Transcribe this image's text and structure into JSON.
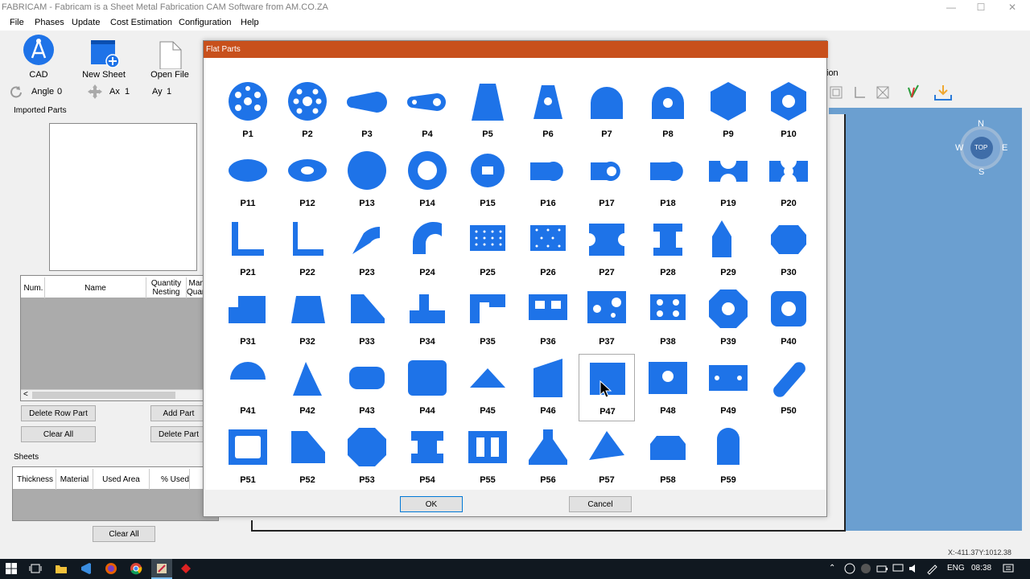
{
  "window": {
    "title": "FABRICAM - Fabricam is a Sheet Metal Fabrication CAM Software from AM.CO.ZA",
    "min": "—",
    "max": "☐",
    "close": "✕"
  },
  "menu": [
    "File",
    "Phases",
    "Update",
    "Cost Estimation",
    "Configuration",
    "Help"
  ],
  "toolbar": {
    "cad": "CAD",
    "new_sheet": "New Sheet",
    "open_file": "Open File",
    "angle_label": "Angle",
    "angle_value": "0",
    "ax_label": "Ax",
    "ax_value": "1",
    "ay_label": "Ay",
    "ay_value": "1"
  },
  "left_panel": {
    "imported_parts": "Imported Parts",
    "columns": [
      "Num.",
      "Name",
      "Quantity Nesting",
      "Man Quan"
    ],
    "delete_row": "Delete Row Part",
    "add_part": "Add Part",
    "clear_all": "Clear All",
    "delete_part": "Delete Part",
    "sheets": "Sheets",
    "sheet_columns": [
      "Thickness",
      "Material",
      "Used Area",
      "% Used"
    ],
    "sheets_clear_all": "Clear All"
  },
  "right": {
    "partial_tab": "ion",
    "compass": {
      "n": "N",
      "s": "S",
      "e": "E",
      "w": "W",
      "center": "TOP"
    },
    "coords": "X:-411.37Y:1012.38"
  },
  "dialog": {
    "title": "Flat Parts",
    "ok": "OK",
    "cancel": "Cancel",
    "selected": "P47",
    "parts": [
      "P1",
      "P2",
      "P3",
      "P4",
      "P5",
      "P6",
      "P7",
      "P8",
      "P9",
      "P10",
      "P11",
      "P12",
      "P13",
      "P14",
      "P15",
      "P16",
      "P17",
      "P18",
      "P19",
      "P20",
      "P21",
      "P22",
      "P23",
      "P24",
      "P25",
      "P26",
      "P27",
      "P28",
      "P29",
      "P30",
      "P31",
      "P32",
      "P33",
      "P34",
      "P35",
      "P36",
      "P37",
      "P38",
      "P39",
      "P40",
      "P41",
      "P42",
      "P43",
      "P44",
      "P45",
      "P46",
      "P47",
      "P48",
      "P49",
      "P50",
      "P51",
      "P52",
      "P53",
      "P54",
      "P55",
      "P56",
      "P57",
      "P58",
      "P59"
    ]
  },
  "taskbar": {
    "lang": "ENG",
    "time": "08:38"
  },
  "colors": {
    "accent": "#c8501c",
    "part_blue": "#1e73e8",
    "canvas_blue": "#6b9fd0"
  }
}
